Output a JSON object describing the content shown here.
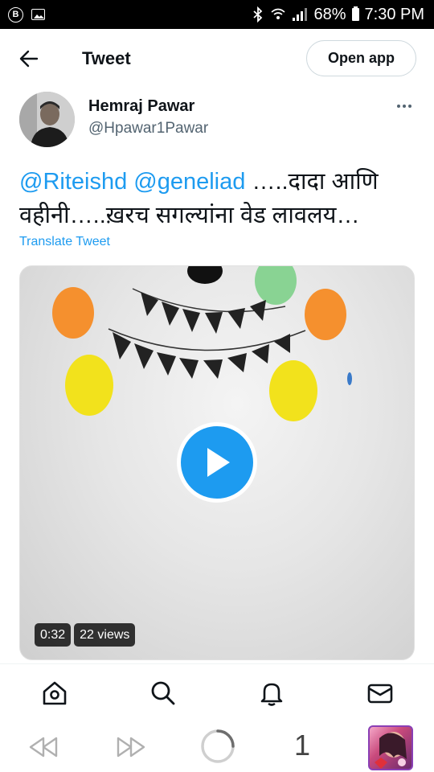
{
  "status_bar": {
    "battery": "68%",
    "time": "7:30 PM",
    "b_icon": "B"
  },
  "header": {
    "title": "Tweet",
    "open_app_label": "Open app"
  },
  "author": {
    "name": "Hemraj Pawar",
    "handle": "@Hpawar1Pawar"
  },
  "tweet": {
    "mention1": "@Riteishd",
    "mention2": "@geneliad",
    "body": " …..दादा आणि वहीनी…..ख़रच सगल्यांना वेड लावलय…",
    "translate_label": "Translate Tweet"
  },
  "media": {
    "duration": "0:32",
    "views": "22 views"
  },
  "bottom_nav": {
    "icons": [
      "home-icon",
      "search-icon",
      "bell-icon",
      "mail-icon"
    ]
  },
  "browser": {
    "tab_count": "1"
  },
  "colors": {
    "accent": "#1d9bf0",
    "text": "#0f1419",
    "secondary": "#536471"
  }
}
